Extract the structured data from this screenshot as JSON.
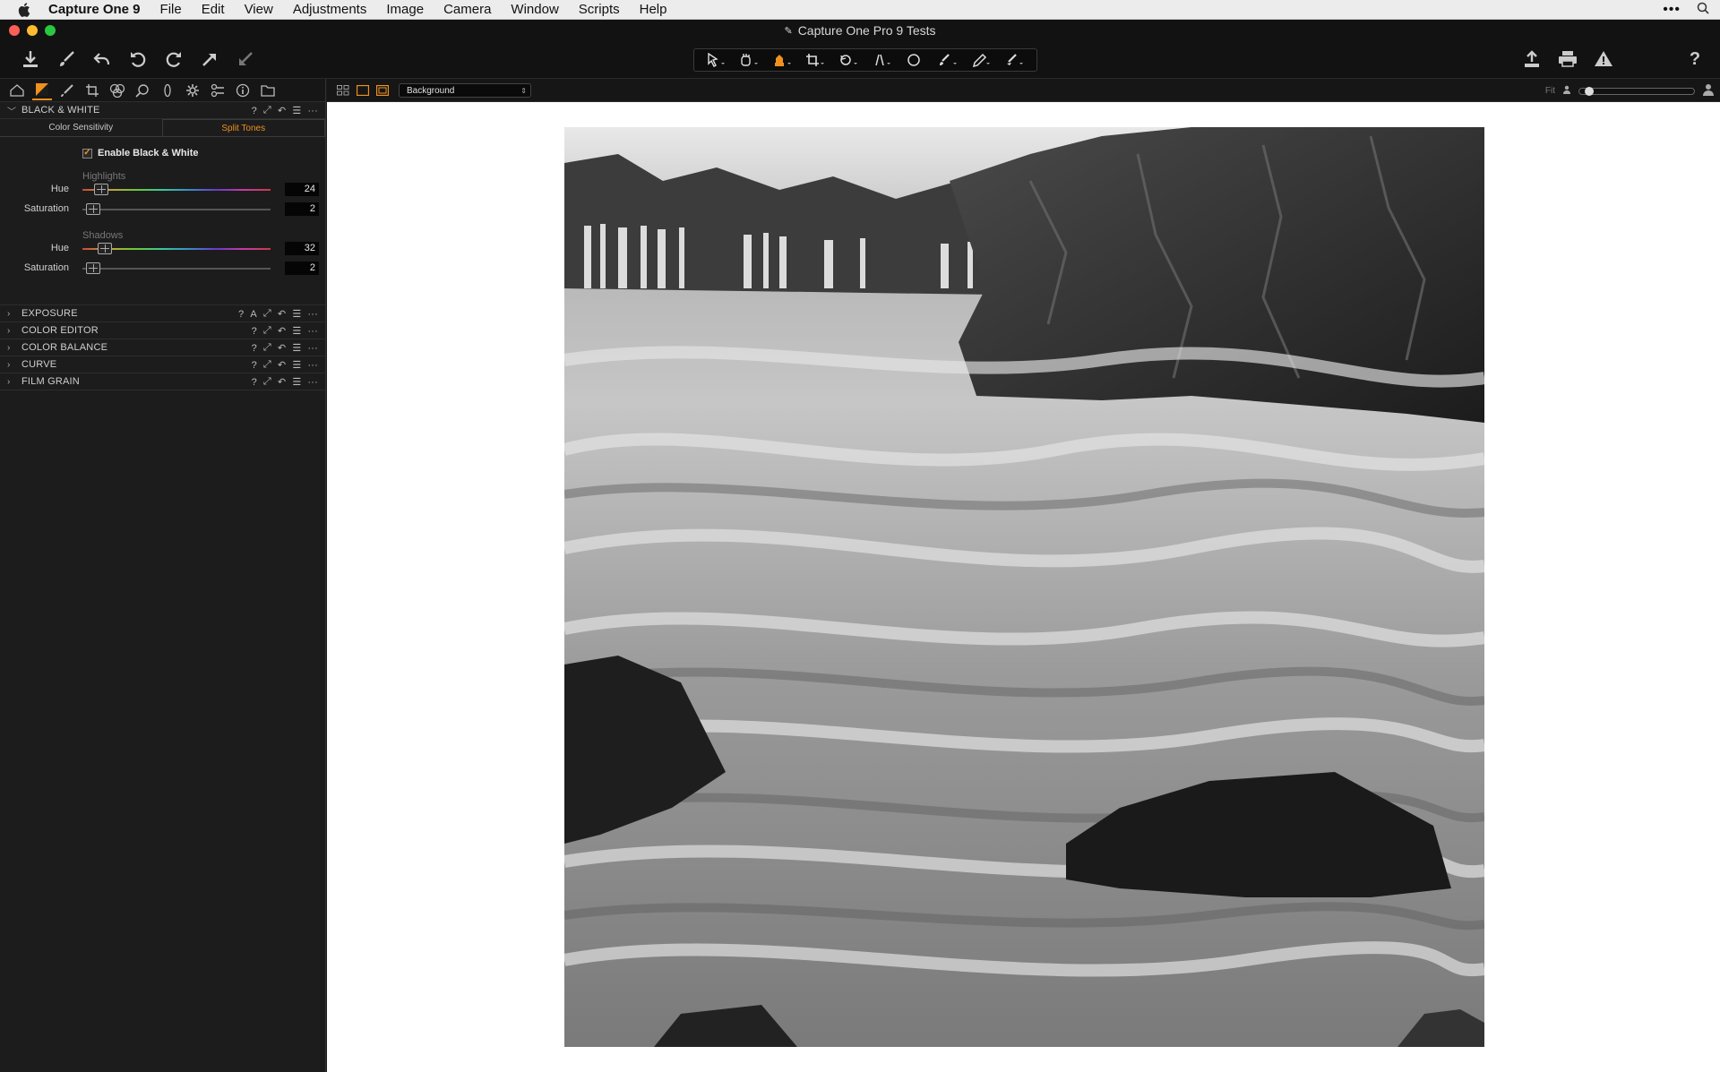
{
  "menubar": {
    "app_name": "Capture One 9",
    "items": [
      "File",
      "Edit",
      "View",
      "Adjustments",
      "Image",
      "Camera",
      "Window",
      "Scripts",
      "Help"
    ]
  },
  "window": {
    "title": "Capture One Pro 9 Tests"
  },
  "toolbar": {
    "left_icons": [
      "import-icon",
      "brush-icon",
      "undo-all-icon",
      "rotate-left-icon",
      "rotate-right-icon",
      "apply-icon",
      "copy-adjustments-icon"
    ],
    "center_icons": [
      "pointer-icon",
      "hand-icon",
      "bucket-icon",
      "crop-icon",
      "rotate-icon",
      "keystone-icon",
      "circle-icon",
      "draw-mask-icon",
      "picker-icon",
      "annotate-icon"
    ],
    "right_icons": [
      "export-icon",
      "print-icon",
      "warning-icon",
      "help-icon"
    ]
  },
  "tool_tabs": [
    "library-icon",
    "color-icon",
    "adjust-icon",
    "crop-tab-icon",
    "lens-icon",
    "focus-icon",
    "details-icon",
    "settings-icon",
    "batch-icon",
    "info-icon",
    "folder-icon"
  ],
  "black_white": {
    "title": "BLACK & WHITE",
    "subtab_color": "Color Sensitivity",
    "subtab_split": "Split Tones",
    "enable_label": "Enable Black & White",
    "enabled": true,
    "highlights_label": "Highlights",
    "shadows_label": "Shadows",
    "highlights_hue_label": "Hue",
    "highlights_hue_value": "24",
    "highlights_hue_fraction": 0.067,
    "highlights_sat_label": "Saturation",
    "highlights_sat_value": "2",
    "highlights_sat_fraction": 0.02,
    "shadows_hue_label": "Hue",
    "shadows_hue_value": "32",
    "shadows_hue_fraction": 0.089,
    "shadows_sat_label": "Saturation",
    "shadows_sat_value": "2",
    "shadows_sat_fraction": 0.02
  },
  "sections": {
    "exposure": "EXPOSURE",
    "color_editor": "COLOR EDITOR",
    "color_balance": "COLOR BALANCE",
    "curve": "CURVE",
    "film_grain": "FILM GRAIN"
  },
  "viewer": {
    "background_select": "Background",
    "fit_label": "Fit"
  },
  "colors": {
    "accent": "#f0901f",
    "panel_bg": "#1c1c1c",
    "viewer_bg": "#ffffff"
  }
}
